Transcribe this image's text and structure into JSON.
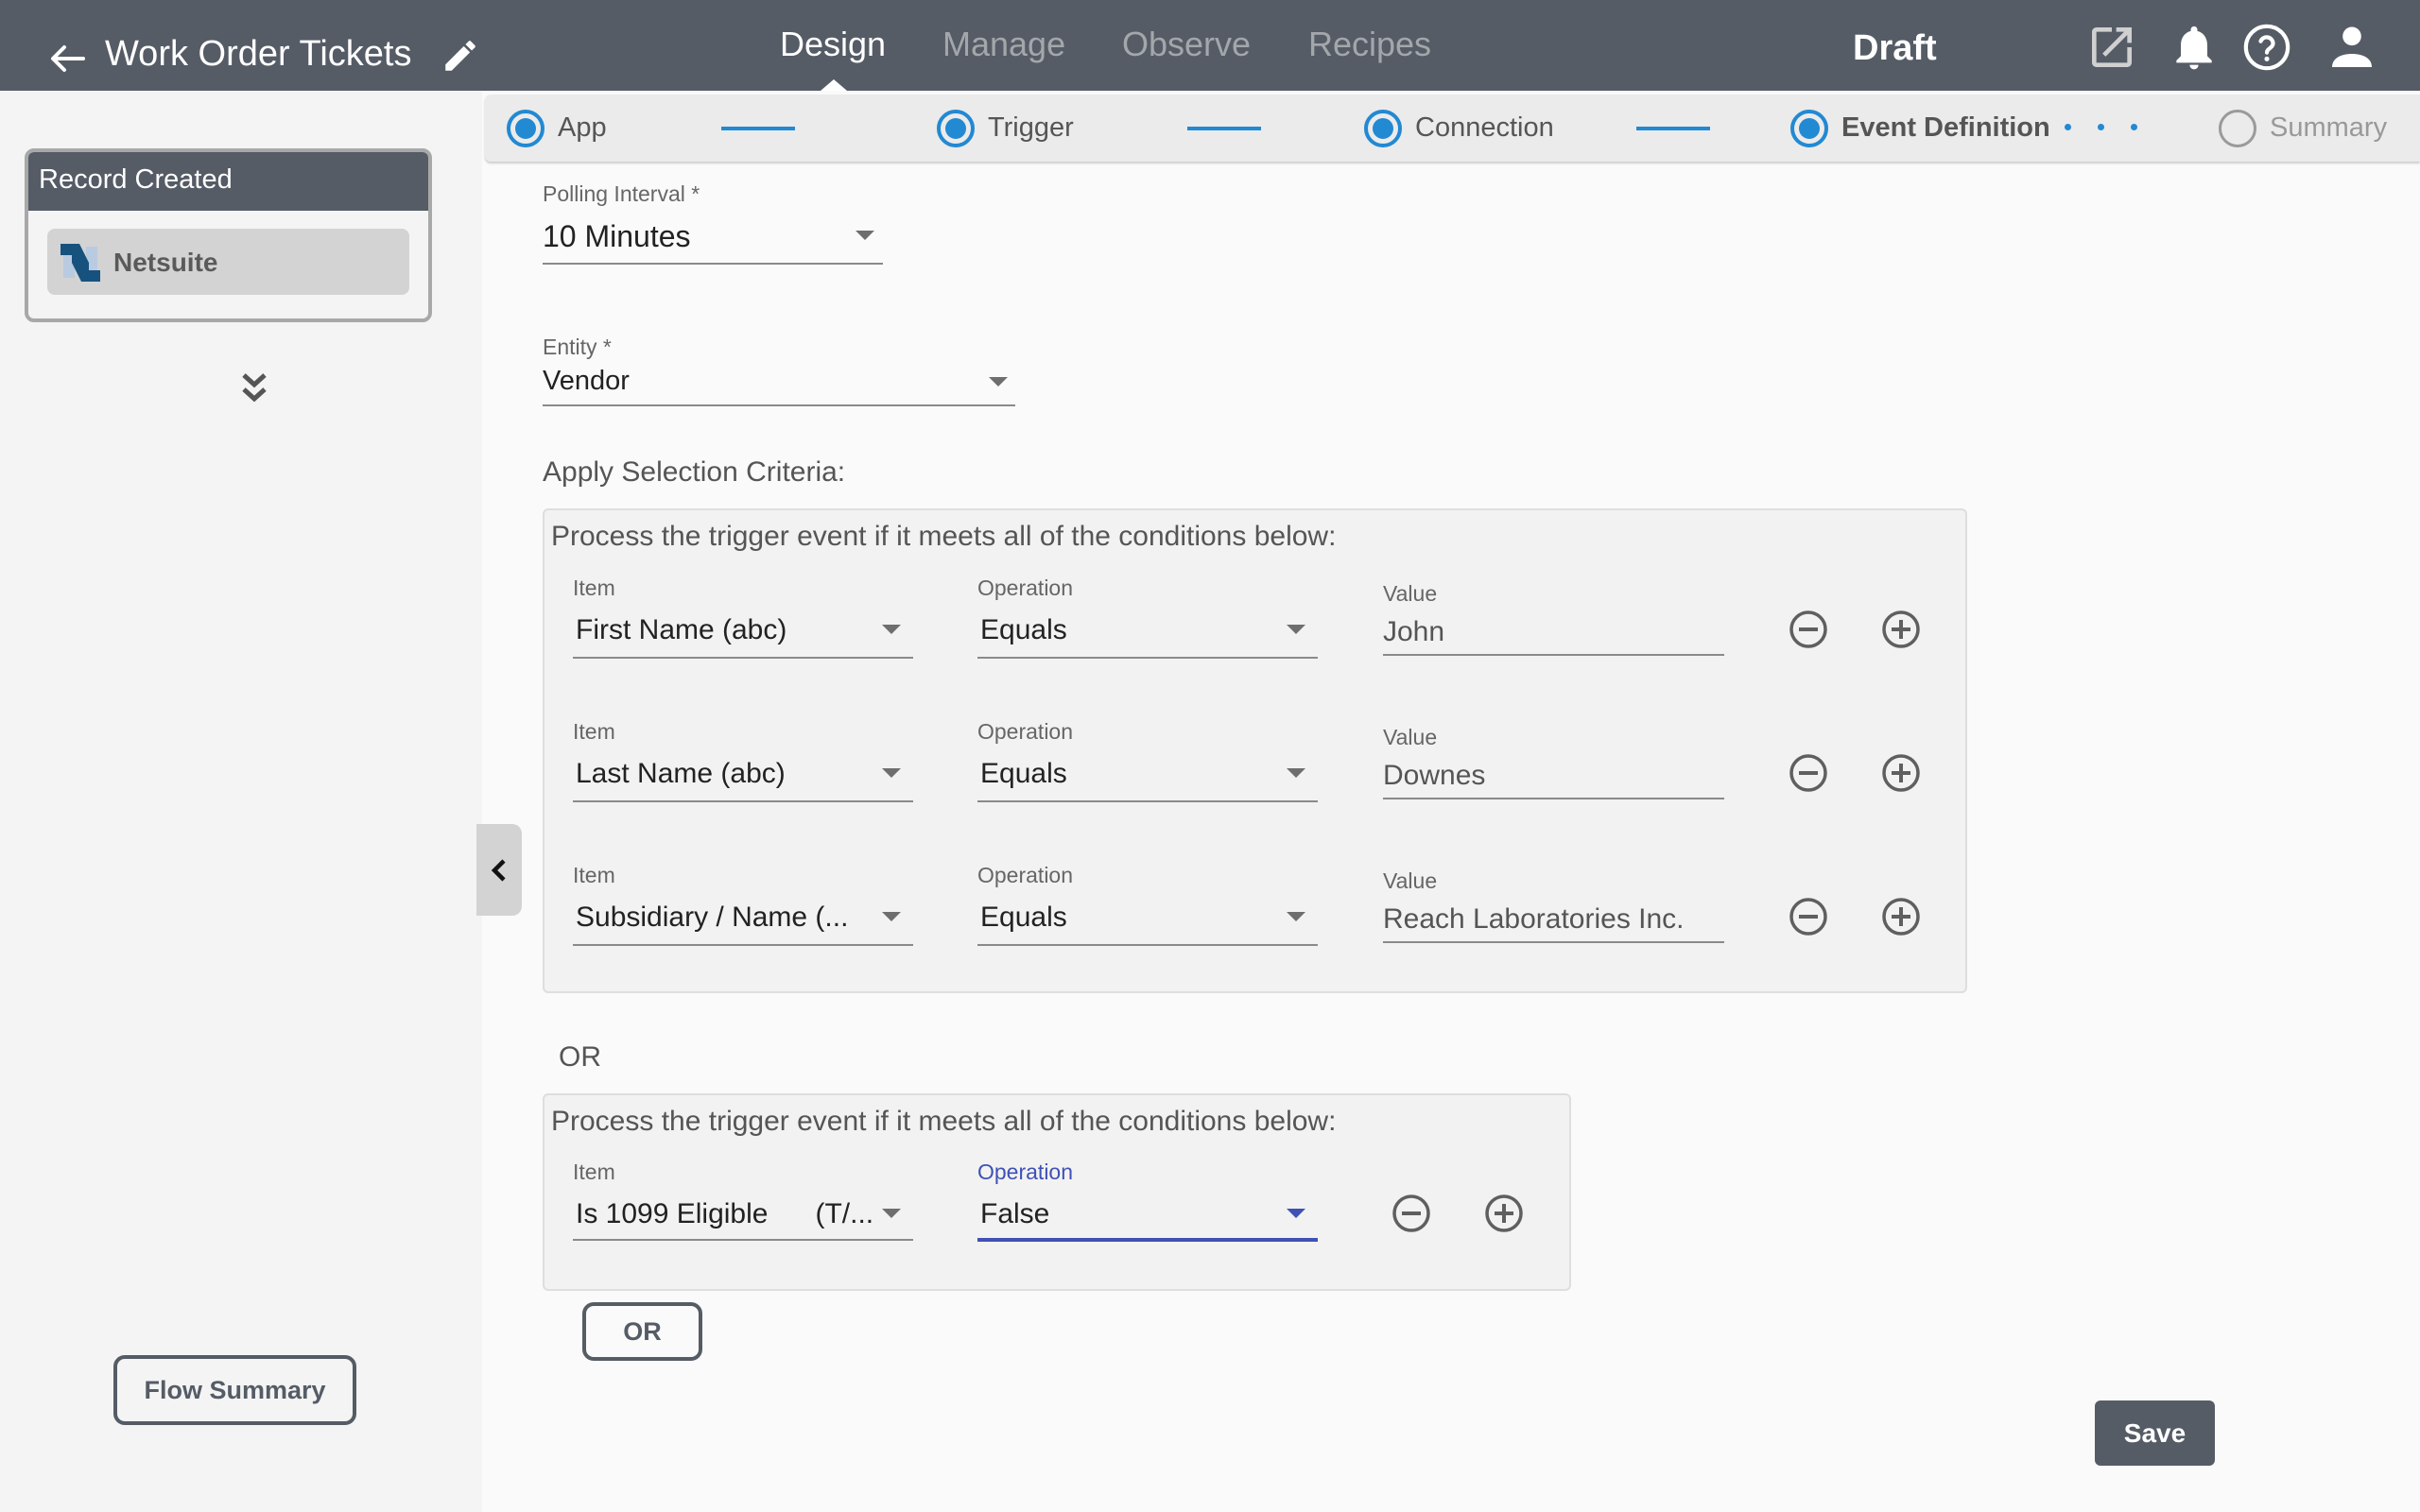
{
  "header": {
    "back_icon": "arrow-left-icon",
    "title": "Work Order Tickets",
    "edit_icon": "pencil-icon",
    "tabs": [
      {
        "label": "Design",
        "active": true
      },
      {
        "label": "Manage",
        "active": false
      },
      {
        "label": "Observe",
        "active": false
      },
      {
        "label": "Recipes",
        "active": false
      }
    ],
    "status": "Draft",
    "icons": [
      "open-in-new-icon",
      "bell-icon",
      "help-circle-icon",
      "user-icon"
    ]
  },
  "stepper": {
    "steps": [
      {
        "label": "App",
        "state": "complete"
      },
      {
        "label": "Trigger",
        "state": "complete"
      },
      {
        "label": "Connection",
        "state": "complete"
      },
      {
        "label": "Event Definition",
        "state": "current"
      },
      {
        "label": "Summary",
        "state": "pending"
      }
    ],
    "accent_color": "#2289d3"
  },
  "sidebar": {
    "card_title": "Record Created",
    "app_name": "Netsuite",
    "app_icon": "netsuite-logo",
    "expand_icon": "double-chevron-down-icon",
    "flow_summary_label": "Flow Summary",
    "collapse_icon": "chevron-left-icon"
  },
  "form": {
    "polling_interval": {
      "label": "Polling Interval *",
      "value": "10 Minutes"
    },
    "entity": {
      "label": "Entity *",
      "value": "Vendor"
    },
    "criteria_heading": "Apply Selection Criteria:",
    "groups": [
      {
        "title": "Process the trigger event if it meets all of the conditions below:",
        "conditions": [
          {
            "item_label": "Item",
            "item": "First Name   (abc)",
            "operation_label": "Operation",
            "operation": "Equals",
            "value_label": "Value",
            "value": "John"
          },
          {
            "item_label": "Item",
            "item": "Last Name   (abc)",
            "operation_label": "Operation",
            "operation": "Equals",
            "value_label": "Value",
            "value": "Downes"
          },
          {
            "item_label": "Item",
            "item": "Subsidiary / Name   (...",
            "operation_label": "Operation",
            "operation": "Equals",
            "value_label": "Value",
            "value": "Reach Laboratories Inc."
          }
        ]
      },
      {
        "title": "Process the trigger event if it meets all of the conditions below:",
        "conditions": [
          {
            "item_label": "Item",
            "item": "Is 1099 Eligible      (T/...",
            "operation_label": "Operation",
            "operation": "False",
            "focused": true
          }
        ]
      }
    ],
    "or_separator": "OR",
    "or_button": "OR",
    "remove_icon": "minus-circle-icon",
    "add_icon": "plus-circle-icon",
    "focus_color": "#3f51b5"
  },
  "footer": {
    "save_label": "Save"
  },
  "colors": {
    "header_bg": "#555c66",
    "sidebar_bg": "#f4f4f4",
    "main_bg": "#fafafa"
  }
}
